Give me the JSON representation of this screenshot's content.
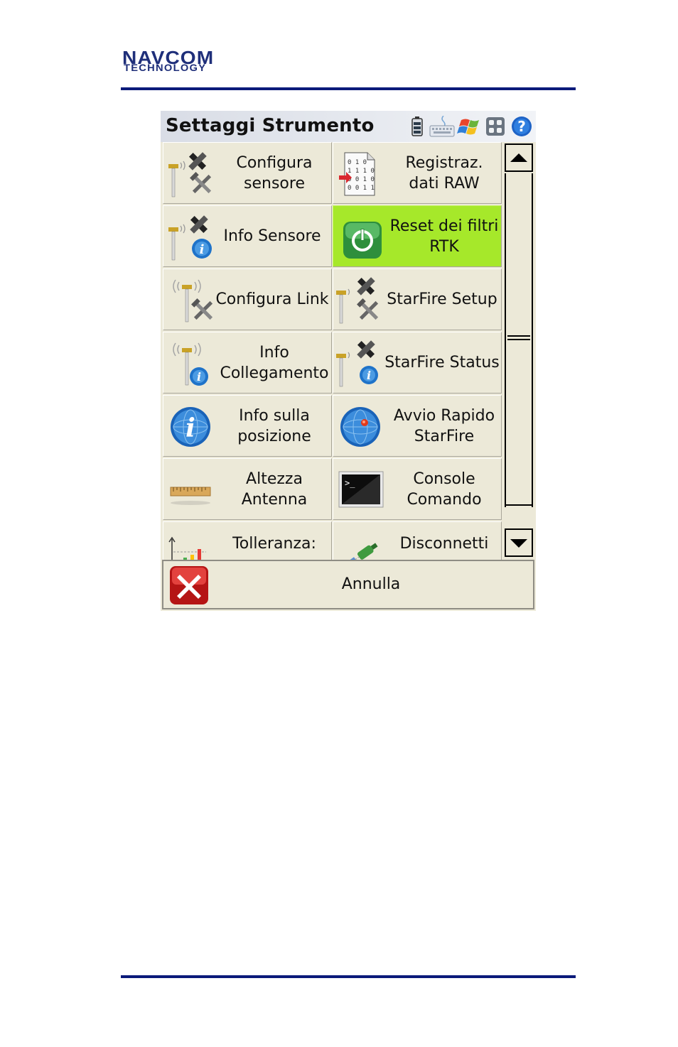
{
  "brand": {
    "line1": "NAVCOM",
    "line2": "TECHNOLOGY",
    "color": "#1f2f7a"
  },
  "window": {
    "title": "Settaggi Strumento",
    "tray_icons": [
      "battery-icon",
      "keyboard-icon",
      "windows-flag-icon",
      "calculator-icon",
      "help-icon"
    ]
  },
  "grid": {
    "highlight_color": "#a6e82a",
    "items": [
      {
        "label": "Configura sensore",
        "icon": "gps-rod-satellite-tools-icon"
      },
      {
        "label": "Registraz. dati RAW",
        "icon": "binary-file-icon"
      },
      {
        "label": "Info Sensore",
        "icon": "gps-rod-satellite-info-icon"
      },
      {
        "label": "Reset dei filtri RTK",
        "icon": "power-button-icon",
        "selected": true
      },
      {
        "label": "Configura Link",
        "icon": "radio-rod-tools-icon"
      },
      {
        "label": "StarFire Setup",
        "icon": "starfire-satellite-tools-icon"
      },
      {
        "label": "Info Collegamento",
        "icon": "radio-rod-info-icon"
      },
      {
        "label": "StarFire Status",
        "icon": "starfire-satellite-info-icon"
      },
      {
        "label": "Info sulla posizione",
        "icon": "info-globe-icon"
      },
      {
        "label": "Avvio Rapido StarFire",
        "icon": "globe-pin-icon"
      },
      {
        "label": "Altezza Antenna",
        "icon": "measuring-tape-icon"
      },
      {
        "label": "Console Comando",
        "icon": "terminal-icon"
      },
      {
        "label": "Tolleranza:",
        "icon": "tolerance-chart-icon"
      },
      {
        "label": "Disconnetti",
        "icon": "plug-disconnect-icon"
      }
    ]
  },
  "scrollbar": {
    "up": "scroll-up-arrow-icon",
    "down": "scroll-down-arrow-icon"
  },
  "cancel": {
    "label": "Annulla",
    "icon": "red-x-icon"
  }
}
